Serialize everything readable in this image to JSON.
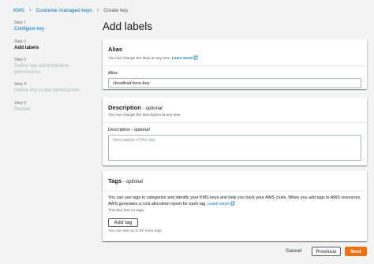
{
  "breadcrumb": {
    "items": [
      "KMS",
      "Customer managed keys",
      "Create key"
    ]
  },
  "steps": [
    {
      "number": "Step 1",
      "name": "Configure key",
      "state": "done"
    },
    {
      "number": "Step 2",
      "name": "Add labels",
      "state": "current"
    },
    {
      "number": "Step 3",
      "name": "Define key administrative permissions",
      "state": "todo"
    },
    {
      "number": "Step 4",
      "name": "Define key usage permissions",
      "state": "todo"
    },
    {
      "number": "Step 5",
      "name": "Review",
      "state": "todo"
    }
  ],
  "page_title": "Add labels",
  "alias": {
    "title": "Alias",
    "description": "You can change the alias at any time.",
    "learn_more": "Learn more",
    "field_label": "Alias",
    "value": "cloudtrail-kms-key"
  },
  "description_panel": {
    "title": "Description",
    "optional": "- optional",
    "description": "You can change the description at any time.",
    "field_label": "Description",
    "field_optional": "- optional",
    "placeholder": "Description of the key"
  },
  "tags": {
    "title": "Tags",
    "optional": "- optional",
    "body_text": "You can use tags to categorize and identify your KMS keys and help you track your AWS costs. When you add tags to AWS resources, AWS generates a cost allocation report for each tag.",
    "learn_more": "Learn more",
    "empty_text": "This key has no tags.",
    "add_button": "Add tag",
    "limit_text": "You can add up to 50 more tags."
  },
  "footer": {
    "cancel": "Cancel",
    "previous": "Previous",
    "next": "Next"
  },
  "colors": {
    "link": "#0073bb",
    "primary_button": "#ec7211",
    "background": "#f2f3f3"
  }
}
